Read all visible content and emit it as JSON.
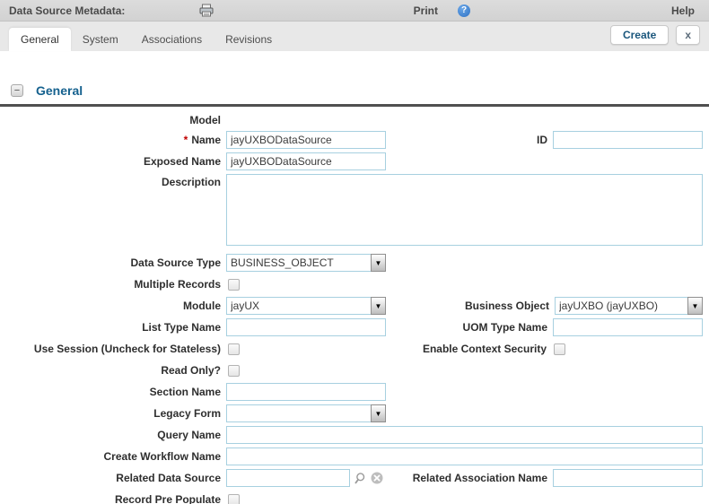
{
  "header": {
    "title": "Data Source Metadata:",
    "print_label": "Print",
    "help_label": "Help",
    "help_glyph": "?"
  },
  "tabs": {
    "general": "General",
    "system": "System",
    "associations": "Associations",
    "revisions": "Revisions"
  },
  "actions": {
    "create_label": "Create",
    "close_label": "x"
  },
  "section": {
    "title": "General",
    "collapse_glyph": "−"
  },
  "form": {
    "required_marker": "*",
    "model": {
      "label": "Model"
    },
    "name": {
      "label": "Name",
      "value": "jayUXBODataSource"
    },
    "id": {
      "label": "ID",
      "value": ""
    },
    "exposed_name": {
      "label": "Exposed Name",
      "value": "jayUXBODataSource"
    },
    "description": {
      "label": "Description",
      "value": ""
    },
    "data_source_type": {
      "label": "Data Source Type",
      "value": "BUSINESS_OBJECT"
    },
    "multiple_records": {
      "label": "Multiple Records",
      "checked": false
    },
    "module": {
      "label": "Module",
      "value": "jayUX"
    },
    "business_object": {
      "label": "Business Object",
      "value": "jayUXBO (jayUXBO)"
    },
    "list_type_name": {
      "label": "List Type Name",
      "value": ""
    },
    "uom_type_name": {
      "label": "UOM Type Name",
      "value": ""
    },
    "use_session": {
      "label": "Use Session (Uncheck for Stateless)",
      "checked": false
    },
    "enable_context_security": {
      "label": "Enable Context Security",
      "checked": false
    },
    "read_only": {
      "label": "Read Only?",
      "checked": false
    },
    "section_name": {
      "label": "Section Name",
      "value": ""
    },
    "legacy_form": {
      "label": "Legacy Form",
      "value": ""
    },
    "query_name": {
      "label": "Query Name",
      "value": ""
    },
    "create_workflow_name": {
      "label": "Create Workflow Name",
      "value": ""
    },
    "related_data_source": {
      "label": "Related Data Source",
      "value": ""
    },
    "related_association_name": {
      "label": "Related Association Name",
      "value": ""
    },
    "record_pre_populate": {
      "label": "Record Pre Populate",
      "checked": false
    }
  },
  "select_arrow_glyph": "▼",
  "colors": {
    "accent_blue": "#15618e",
    "input_border": "#a7d0e0",
    "required_red": "#c00000",
    "rule_dark": "#4f4f4f"
  }
}
